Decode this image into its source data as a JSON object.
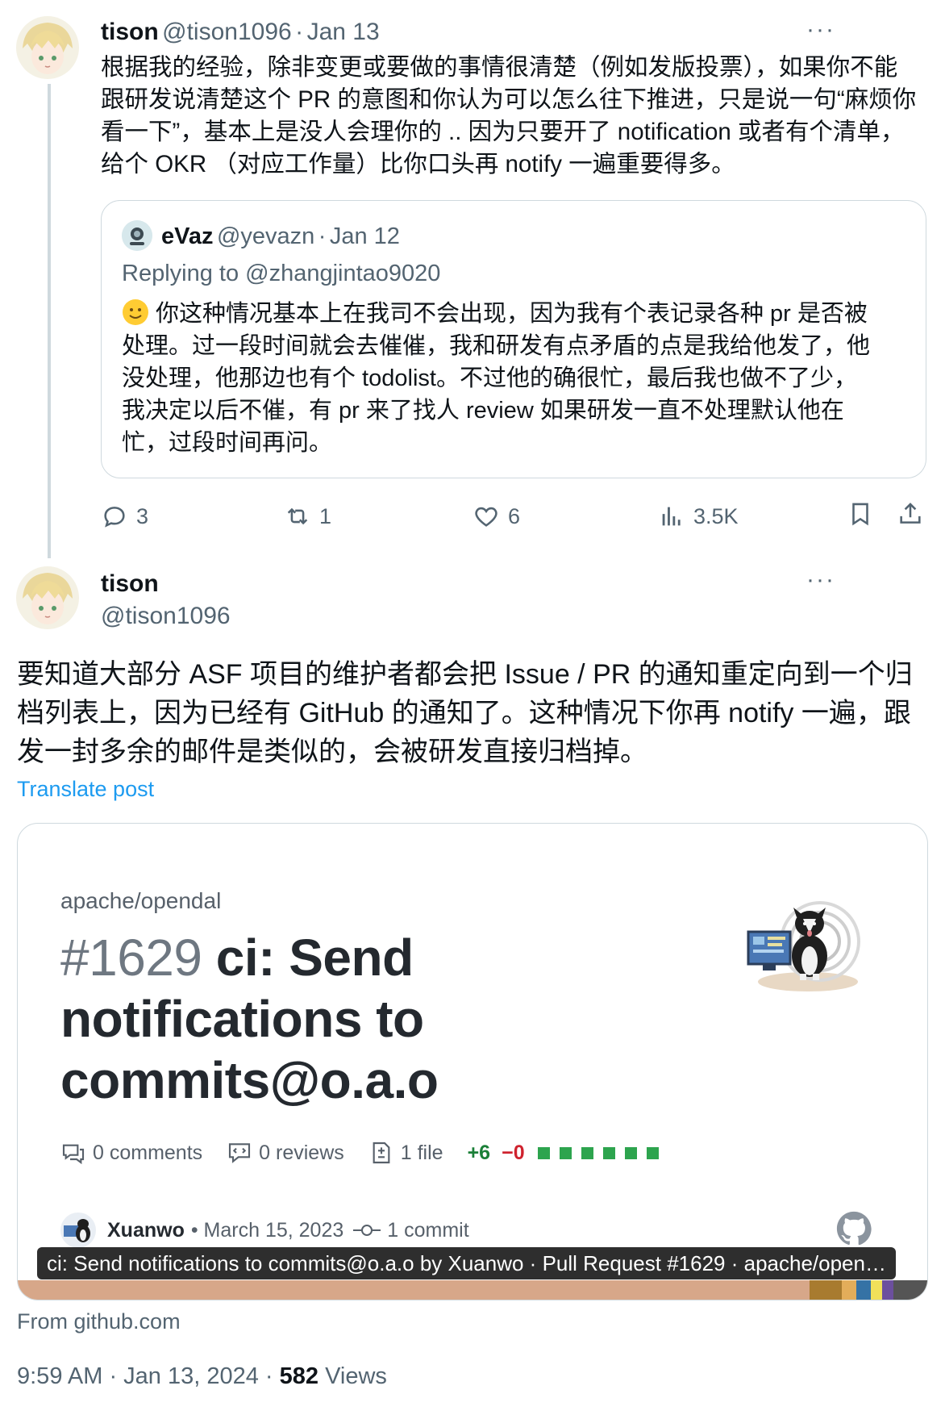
{
  "tweet1": {
    "name": "tison",
    "handle": "@tison1096",
    "date": "Jan 13",
    "text": "根据我的经验，除非变更或要做的事情很清楚（例如发版投票），如果你不能\n跟研发说清楚这个 PR 的意图和你认为可以怎么往下推进，只是说一句“麻烦你\n看一下”，基本上是没人会理你的 .. 因为只要开了 notification 或者有个清单，\n给个 OKR （对应工作量）比你口头再 notify 一遍重要得多。",
    "more": "···",
    "quote": {
      "name": "eVaz",
      "handle": "@yevazn",
      "date": "Jan 12",
      "replying": "Replying to @zhangjintao9020",
      "text": "你这种情况基本上在我司不会出现，因为我有个表记录各种 pr 是否被\n处理。过一段时间就会去催催，我和研发有点矛盾的点是我给他发了，他\n没处理，他那边也有个 todolist。不过他的确很忙，最后我也做不了少，\n我决定以后不催，有 pr 来了找人 review 如果研发一直不处理默认他在\n忙，过段时间再问。"
    },
    "actions": {
      "replies": "3",
      "reposts": "1",
      "likes": "6",
      "views": "3.5K"
    }
  },
  "tweet2": {
    "name": "tison",
    "handle": "@tison1096",
    "more": "···",
    "text": "要知道大部分 ASF 项目的维护者都会把 Issue / PR 的通知重定向到一个归\n档列表上，因为已经有 GitHub 的通知了。这种情况下你再 notify 一遍，跟\n发一封多余的邮件是类似的，会被研发直接归档掉。",
    "translate": "Translate post",
    "card": {
      "repo": "apache/opendal",
      "pr_number": "#1629",
      "title": "ci: Send notifications to commits@o.a.o",
      "comments": "0 comments",
      "reviews": "0 reviews",
      "files": "1 file",
      "additions": "+6",
      "deletions": "−0",
      "author": "Xuanwo",
      "date": "• March 15, 2023",
      "commits": "1 commit",
      "tooltip": "ci: Send notifications to commits@o.a.o by Xuanwo · Pull Request #1629 · apache/open…",
      "bar_colors": [
        "#d7a789",
        "#a87b2f",
        "#e3ad5a",
        "#3572a5",
        "#f1e05a",
        "#6c4f9e",
        "#555555"
      ]
    },
    "from": "From github.com",
    "time": "9:59 AM · Jan 13, 2024 · ",
    "views_count": "582",
    "views_label": " Views"
  }
}
